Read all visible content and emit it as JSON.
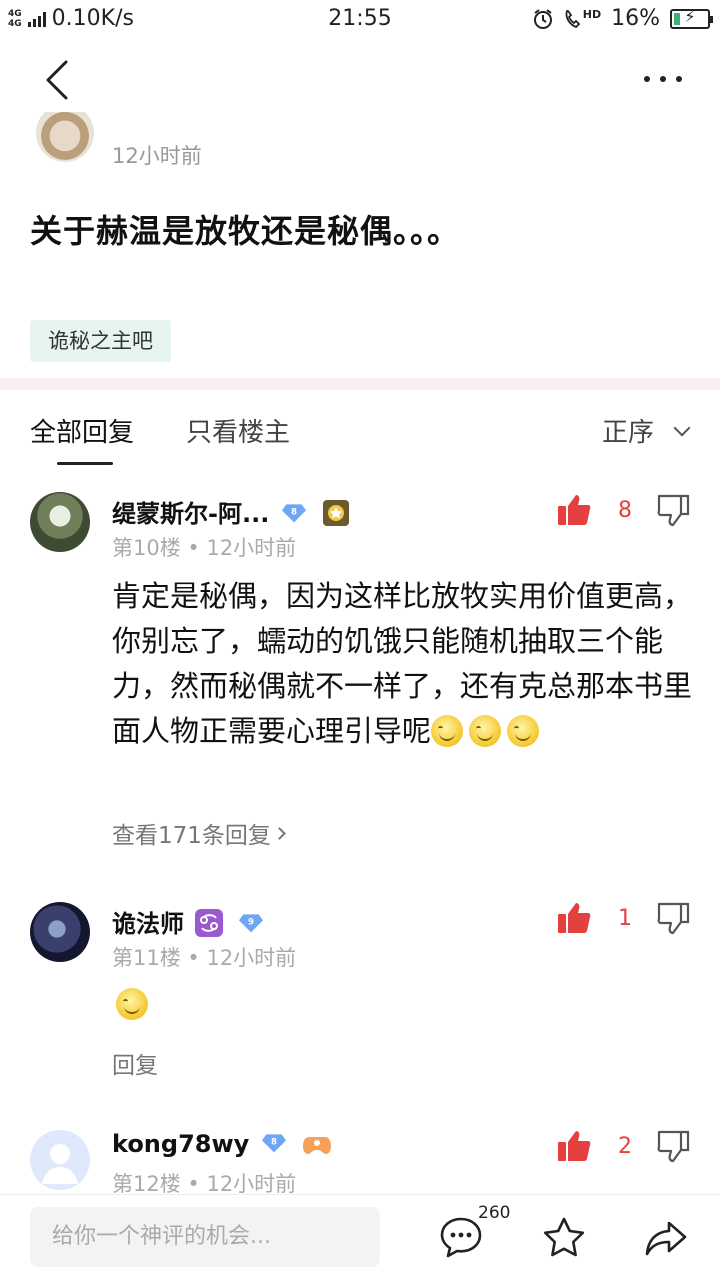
{
  "status_bar": {
    "net_top": "4G",
    "net_bottom": "4G",
    "speed": "0.10K/s",
    "time": "21:55",
    "hd": "HD",
    "battery_pct": "16%",
    "battery_level": 0.16
  },
  "nav": {
    "back": "back-icon",
    "more": "more-icon"
  },
  "post": {
    "time": "12小时前",
    "title": "关于赫温是放牧还是秘偶。。。",
    "forum_tag": "诡秘之主吧"
  },
  "tabs": {
    "all": "全部回复",
    "owner_only": "只看楼主",
    "sort": "正序"
  },
  "comments": [
    {
      "name": "缇蒙斯尔-阿...",
      "level": "8",
      "floor_time": "第10楼 • 12小时前",
      "body": "肯定是秘偶，因为这样比放牧实用价值更高，你别忘了，蠕动的饥饿只能随机抽取三个能力，然而秘偶就不一样了，还有克总那本书里面人物正需要心理引导呢",
      "emoji_count": 3,
      "likes": "8",
      "sub_link": "查看171条回复"
    },
    {
      "name": "诡法师",
      "level": "9",
      "floor_time": "第11楼 • 12小时前",
      "likes": "1",
      "sub_link": "回复"
    },
    {
      "name": "kong78wy",
      "level": "8",
      "floor_time": "第12楼 • 12小时前",
      "likes": "2"
    }
  ],
  "bottom_bar": {
    "placeholder": "给你一个神评的机会...",
    "comment_count": "260"
  },
  "colors": {
    "like_red": "#e54040",
    "tag_bg": "#e6f5f1",
    "divider": "#f6f0f4"
  }
}
